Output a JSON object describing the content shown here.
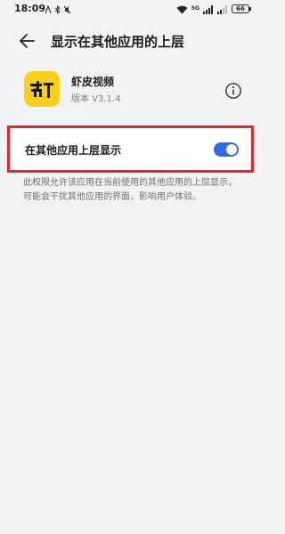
{
  "status_bar": {
    "time": "18:09",
    "network": "5G",
    "battery": "66"
  },
  "header": {
    "title": "显示在其他应用的上层"
  },
  "app": {
    "name": "虾皮视频",
    "version": "版本 V3.1.4",
    "icon": "shrimp-video-logo",
    "icon_color": "#f8cf1a"
  },
  "permission": {
    "label": "在其他应用上层显示",
    "enabled": true,
    "toggle_color": "#2e6be6"
  },
  "description": "此权限允许该应用在当前使用的其他应用的上层显示，可能会干扰其他应用的界面，影响用户体验。",
  "highlight_color": "#e3262b"
}
